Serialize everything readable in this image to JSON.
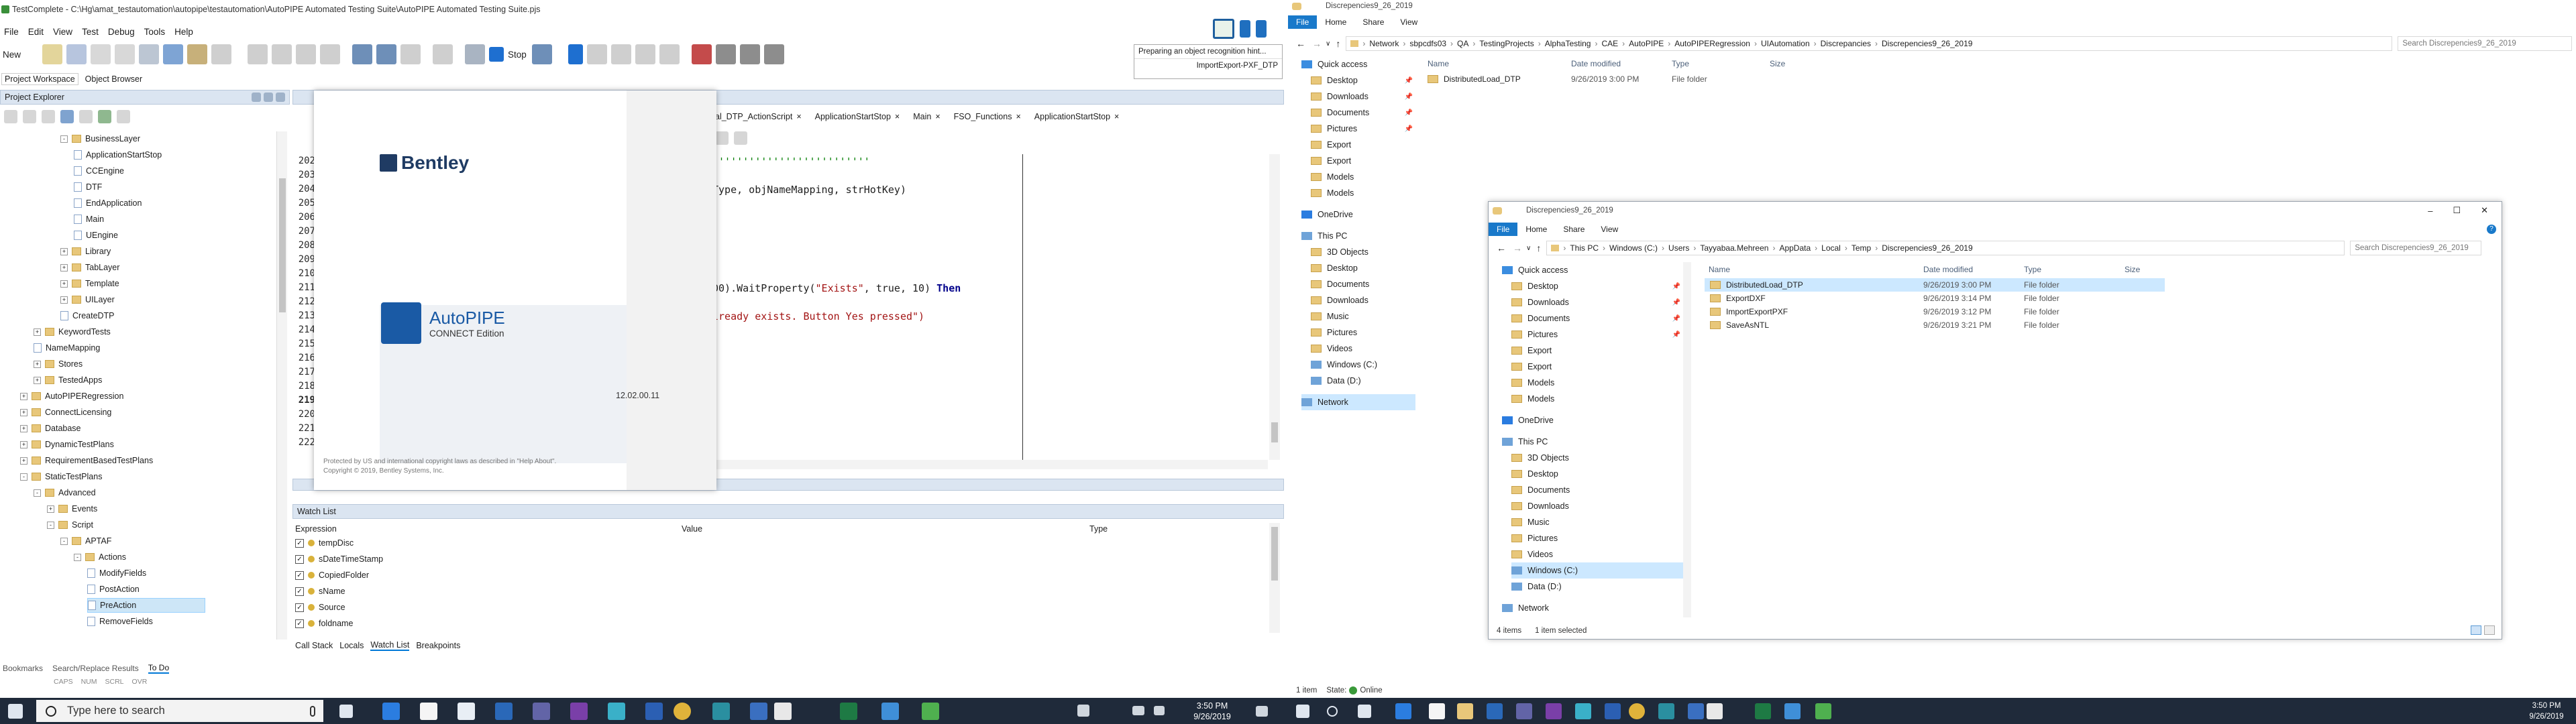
{
  "tc": {
    "title": "TestComplete - C:\\Hg\\amat_testautomation\\autopipe\\testautomation\\AutoPIPE Automated Testing Suite\\AutoPIPE Automated Testing Suite.pjs",
    "menu": [
      "File",
      "Edit",
      "View",
      "Test",
      "Debug",
      "Tools",
      "Help"
    ],
    "toolbar": {
      "new_label": "New",
      "stop_label": "Stop"
    },
    "hint_text": "Preparing an object recognition hint...",
    "hint_sub": "ImportExport-PXF_DTP",
    "panel_tabs": [
      "Project Workspace",
      "Object Browser"
    ],
    "project_explorer_title": "Project Explorer",
    "tree": [
      {
        "label": "BusinessLayer",
        "depth": 3,
        "type": "folder",
        "expand": "-"
      },
      {
        "label": "ApplicationStartStop",
        "depth": 4,
        "type": "page"
      },
      {
        "label": "CCEngine",
        "depth": 4,
        "type": "page"
      },
      {
        "label": "DTF",
        "depth": 4,
        "type": "page"
      },
      {
        "label": "EndApplication",
        "depth": 4,
        "type": "page"
      },
      {
        "label": "Main",
        "depth": 4,
        "type": "page"
      },
      {
        "label": "UEngine",
        "depth": 4,
        "type": "page"
      },
      {
        "label": "Library",
        "depth": 3,
        "type": "folder",
        "expand": "+"
      },
      {
        "label": "TabLayer",
        "depth": 3,
        "type": "folder",
        "expand": "+"
      },
      {
        "label": "Template",
        "depth": 3,
        "type": "folder",
        "expand": "+"
      },
      {
        "label": "UILayer",
        "depth": 3,
        "type": "folder",
        "expand": "+"
      },
      {
        "label": "CreateDTP",
        "depth": 3,
        "type": "page"
      },
      {
        "label": "KeywordTests",
        "depth": 1,
        "type": "folder",
        "expand": "+"
      },
      {
        "label": "NameMapping",
        "depth": 1,
        "type": "page"
      },
      {
        "label": "Stores",
        "depth": 1,
        "type": "folder",
        "expand": "+"
      },
      {
        "label": "TestedApps",
        "depth": 1,
        "type": "folder",
        "expand": "+"
      },
      {
        "label": "AutoPIPERegression",
        "depth": 0,
        "type": "folder",
        "expand": "+"
      },
      {
        "label": "ConnectLicensing",
        "depth": 0,
        "type": "folder",
        "expand": "+"
      },
      {
        "label": "Database",
        "depth": 0,
        "type": "folder",
        "expand": "+"
      },
      {
        "label": "DynamicTestPlans",
        "depth": 0,
        "type": "folder",
        "expand": "+"
      },
      {
        "label": "RequirementBasedTestPlans",
        "depth": 0,
        "type": "folder",
        "expand": "+"
      },
      {
        "label": "StaticTestPlans",
        "depth": 0,
        "type": "folder",
        "expand": "-"
      },
      {
        "label": "Advanced",
        "depth": 1,
        "type": "folder",
        "expand": "-"
      },
      {
        "label": "Events",
        "depth": 2,
        "type": "folder",
        "expand": "+"
      },
      {
        "label": "Script",
        "depth": 2,
        "type": "folder",
        "expand": "-"
      },
      {
        "label": "APTAF",
        "depth": 3,
        "type": "folder",
        "expand": "-"
      },
      {
        "label": "Actions",
        "depth": 4,
        "type": "folder",
        "expand": "-"
      },
      {
        "label": "ModifyFields",
        "depth": 5,
        "type": "page"
      },
      {
        "label": "PostAction",
        "depth": 5,
        "type": "page"
      },
      {
        "label": "PreAction",
        "depth": 5,
        "type": "page",
        "selected": true
      },
      {
        "label": "RemoveFields",
        "depth": 5,
        "type": "page"
      }
    ],
    "editor_tabs": [
      "al_DTP_ActionScript",
      "ApplicationStartStop",
      "Main",
      "FSO_Functions",
      "ApplicationStartStop"
    ],
    "line_numbers": [
      "202",
      "203",
      "204",
      "205",
      "206",
      "207",
      "208",
      "209",
      "210",
      "211",
      "212",
      "213",
      "214",
      "215",
      "216",
      "217",
      "218",
      "219",
      "220",
      "221",
      "222"
    ],
    "code": {
      "l202": "''''''''''''''''''''''''''",
      "l204": "Type, objNameMapping, strHotKey)",
      "l211a": "00).WaitProperty(",
      "l211s": "\"Exists\"",
      "l211b": ", true, 10) ",
      "l211k": "Then",
      "l213": "lready exists. Button Yes pressed\")"
    },
    "watch": {
      "title": "Watch List",
      "headers": [
        "Expression",
        "Value",
        "Type"
      ],
      "items": [
        "tempDisc",
        "sDateTimeStamp",
        "CopiedFolder",
        "sName",
        "Source",
        "foldname"
      ]
    },
    "bottom_tabs": [
      "Call Stack",
      "Locals",
      "Watch List",
      "Breakpoints"
    ],
    "left_bottom_tabs": [
      "Bookmarks",
      "Search/Replace Results",
      "To Do"
    ],
    "status": [
      "CAPS",
      "NUM",
      "SCRL",
      "OVR"
    ]
  },
  "splash": {
    "brand": "Bentley",
    "product": "AutoPIPE",
    "edition": "CONNECT Edition",
    "version": "12.02.00.11",
    "legal1": "Protected by US and international copyright laws as described in \"Help About\".",
    "legal2": "Copyright © 2019, Bentley Systems, Inc."
  },
  "explorer1": {
    "title": "Discrepencies9_26_2019",
    "ribbon": [
      "File",
      "Home",
      "Share",
      "View"
    ],
    "path": [
      "Network",
      "sbpcdfs03",
      "QA",
      "TestingProjects",
      "AlphaTesting",
      "CAE",
      "AutoPIPE",
      "AutoPIPERegression",
      "UIAutomation",
      "Discrepancies",
      "Discrepencies9_26_2019"
    ],
    "search_placeholder": "Search Discrepencies9_26_2019",
    "headers": [
      "Name",
      "Date modified",
      "Type",
      "Size"
    ],
    "rows": [
      {
        "name": "DistributedLoad_DTP",
        "date": "9/26/2019 3:00 PM",
        "type": "File folder"
      }
    ],
    "sidebar": [
      "Quick access",
      "Desktop",
      "Downloads",
      "Documents",
      "Pictures",
      "Export",
      "Export",
      "Models",
      "Models",
      "OneDrive",
      "This PC",
      "3D Objects",
      "Desktop",
      "Documents",
      "Downloads",
      "Music",
      "Pictures",
      "Videos",
      "Windows (C:)",
      "Data (D:)",
      "Network"
    ],
    "status": "1 item",
    "state": "State:",
    "state_val": "Online"
  },
  "explorer2": {
    "title": "Discrepencies9_26_2019",
    "ribbon": [
      "File",
      "Home",
      "Share",
      "View"
    ],
    "path": [
      "This PC",
      "Windows (C:)",
      "Users",
      "Tayyabaa.Mehreen",
      "AppData",
      "Local",
      "Temp",
      "Discrepencies9_26_2019"
    ],
    "search_placeholder": "Search Discrepencies9_26_2019",
    "headers": [
      "Name",
      "Date modified",
      "Type",
      "Size"
    ],
    "rows": [
      {
        "name": "DistributedLoad_DTP",
        "date": "9/26/2019 3:00 PM",
        "type": "File folder"
      },
      {
        "name": "ExportDXF",
        "date": "9/26/2019 3:14 PM",
        "type": "File folder"
      },
      {
        "name": "ImportExportPXF",
        "date": "9/26/2019 3:12 PM",
        "type": "File folder"
      },
      {
        "name": "SaveAsNTL",
        "date": "9/26/2019 3:21 PM",
        "type": "File folder"
      }
    ],
    "sidebar": [
      "Quick access",
      "Desktop",
      "Downloads",
      "Documents",
      "Pictures",
      "Export",
      "Export",
      "Models",
      "Models",
      "OneDrive",
      "This PC",
      "3D Objects",
      "Desktop",
      "Documents",
      "Downloads",
      "Music",
      "Pictures",
      "Videos",
      "Windows (C:)",
      "Data (D:)",
      "Network"
    ],
    "status": "4 items",
    "status_sel": "1 item selected"
  },
  "taskbar": {
    "search_placeholder": "Type here to search",
    "time": "3:50 PM",
    "date": "9/26/2019",
    "time2": "3:50 PM",
    "date2": "9/26/2019"
  },
  "colors": {
    "accent": "#0078d7",
    "bentley": "#1f3b63",
    "keyword": "#00008b",
    "string": "#a31515"
  }
}
